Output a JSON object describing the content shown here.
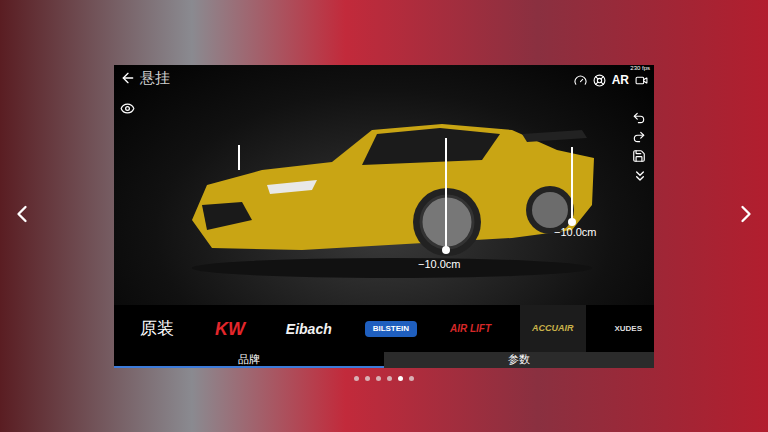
{
  "header": {
    "title": "悬挂",
    "fps": "230 fps",
    "ar": "AR"
  },
  "measurements": [
    {
      "label": "−10.0cm",
      "shown": false
    },
    {
      "label": "−10.0cm",
      "shown": true
    },
    {
      "label": "−10.0cm",
      "shown": true
    }
  ],
  "brands": [
    {
      "name": "原装",
      "selected": false,
      "color": "#ffffff"
    },
    {
      "name": "KW",
      "selected": false,
      "color": "#e3262b"
    },
    {
      "name": "Eibach",
      "selected": false,
      "color": "#f2f2f2"
    },
    {
      "name": "BILSTEIN",
      "selected": false,
      "color": "#1f5fbf"
    },
    {
      "name": "AIR LIFT",
      "selected": false,
      "color": "#d62828"
    },
    {
      "name": "ACCUAIR",
      "selected": true,
      "color": "#c9b24a"
    },
    {
      "name": "XUDES",
      "selected": false,
      "color": "#dddddd"
    }
  ],
  "tabs": [
    {
      "label": "品牌",
      "selected": true
    },
    {
      "label": "参数",
      "selected": false
    }
  ],
  "pager": [
    {
      "selected": false
    },
    {
      "selected": false
    },
    {
      "selected": false
    },
    {
      "selected": false
    },
    {
      "selected": true
    },
    {
      "selected": false
    }
  ]
}
